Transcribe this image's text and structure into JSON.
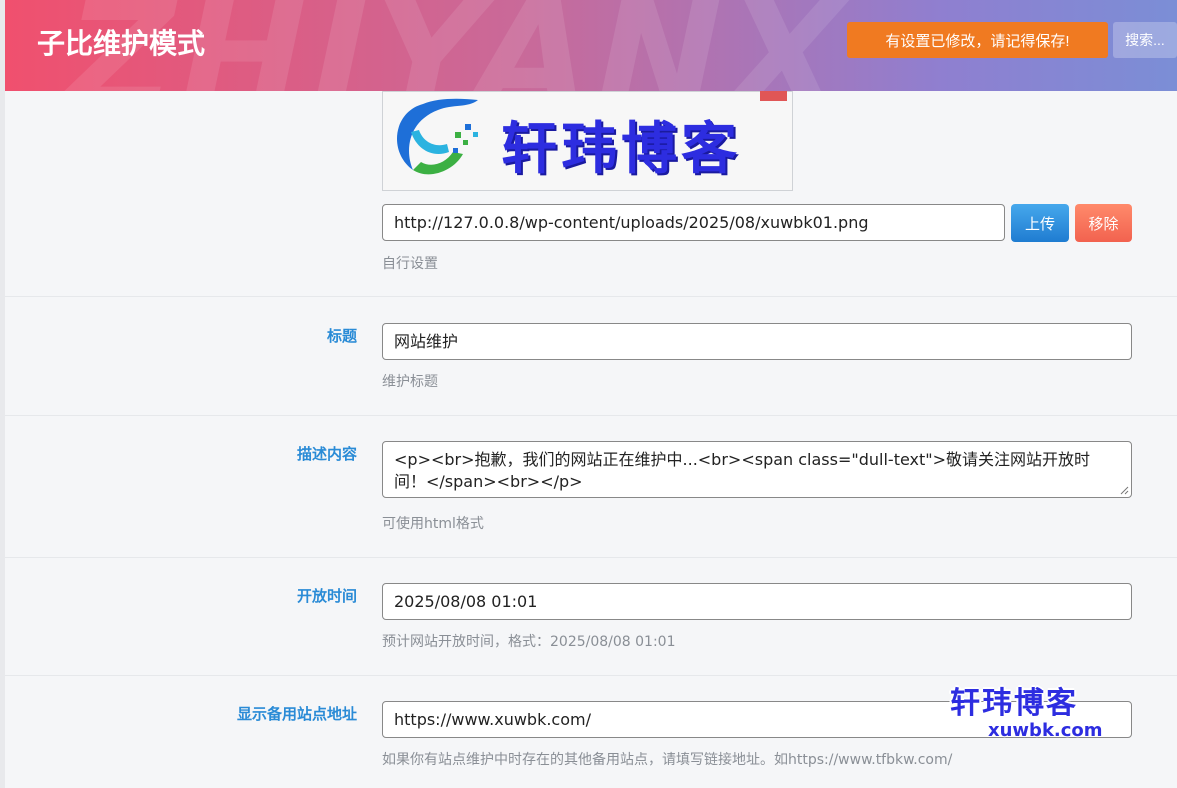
{
  "header": {
    "title": "子比维护模式",
    "watermark": "ZHIYANX",
    "save_notice": "有设置已修改，请记得保存!",
    "search_label": "搜索..."
  },
  "logo_section": {
    "logo_text": "轩玮博客",
    "url_value": "http://127.0.0.8/wp-content/uploads/2025/08/xuwbk01.png",
    "upload_label": "上传",
    "remove_label": "移除",
    "help": "自行设置"
  },
  "title_section": {
    "label": "标题",
    "value": "网站维护",
    "help": "维护标题"
  },
  "description_section": {
    "label": "描述内容",
    "value": "<p><br>抱歉，我们的网站正在维护中...<br><span class=\"dull-text\">敬请关注网站开放时间！</span><br></p>",
    "help": "可使用html格式"
  },
  "open_time_section": {
    "label": "开放时间",
    "value": "2025/08/08 01:01",
    "help": "预计网站开放时间，格式：2025/08/08 01:01"
  },
  "backup_site_section": {
    "label": "显示备用站点地址",
    "value": "https://www.xuwbk.com/",
    "help": "如果你有站点维护中时存在的其他备用站点，请填写链接地址。如https://www.tfbkw.com/"
  },
  "watermark": {
    "title": "轩玮博客",
    "domain": "xuwbk.com"
  },
  "colors": {
    "accent": "#2a8bd6",
    "save_button": "#f07a21",
    "upload_button": "#1f7cd1",
    "remove_button": "#f2624f",
    "logo_text": "#2d2de0"
  }
}
